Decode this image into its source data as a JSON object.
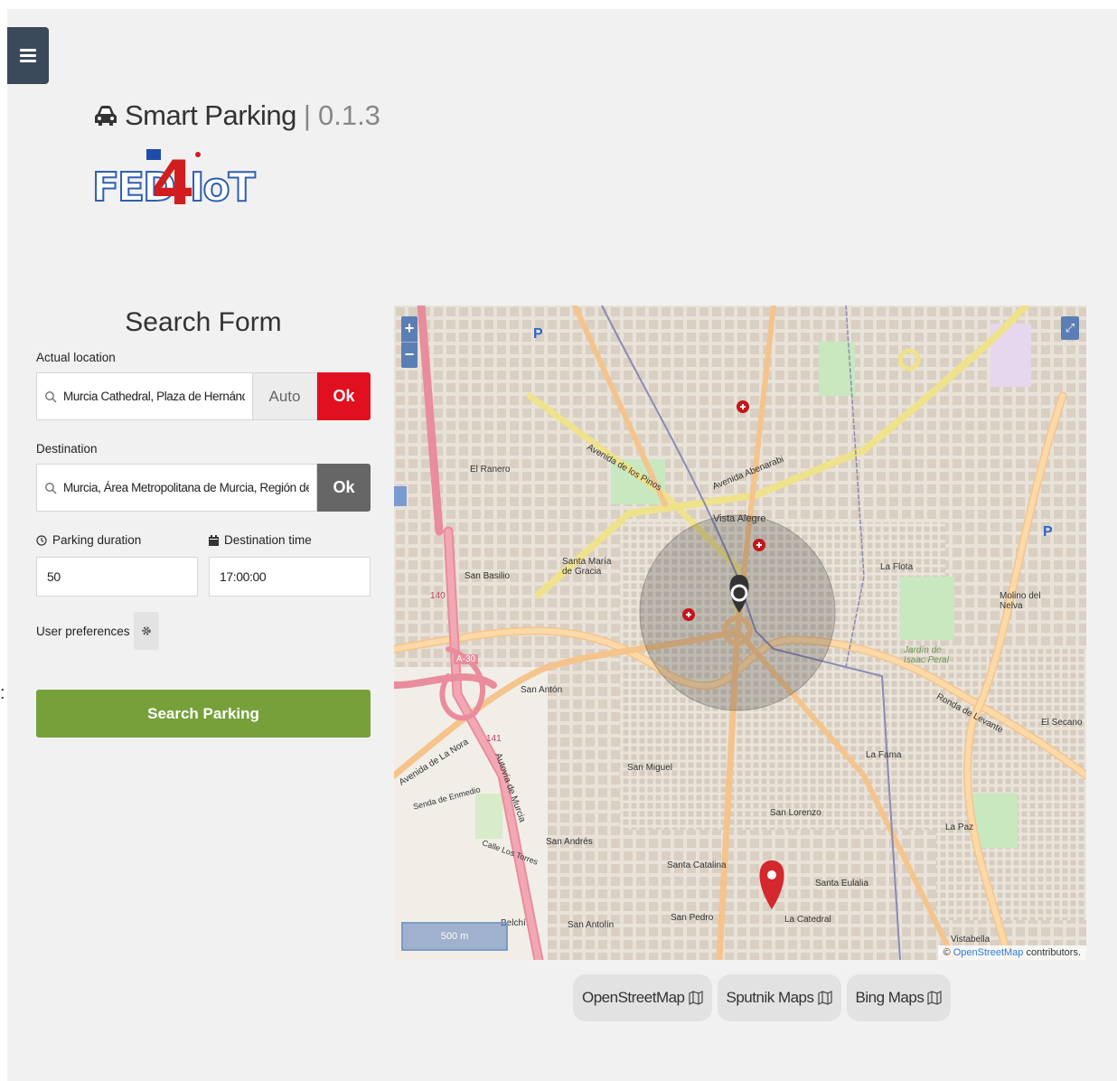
{
  "header": {
    "app_name": "Smart Parking",
    "separator": "|",
    "version": "0.1.3",
    "logo_left": "FED",
    "logo_mid": "4",
    "logo_right": "IoT"
  },
  "form": {
    "title": "Search Form",
    "actual_location_label": "Actual location",
    "actual_location_value": "Murcia Cathedral, Plaza de Hernández Amores",
    "auto_label": "Auto",
    "ok_label": "Ok",
    "destination_label": "Destination",
    "destination_value": "Murcia, Área Metropolitana de Murcia, Región de Murcia",
    "parking_duration_label": "Parking duration",
    "parking_duration_value": "50",
    "destination_time_label": "Destination time",
    "destination_time_value": "17:00:00",
    "user_preferences_label": "User preferences",
    "search_button_label": "Search Parking"
  },
  "map": {
    "zoom_in": "+",
    "zoom_out": "−",
    "scale_label": "500 m",
    "attribution_prefix": "©",
    "attribution_link": "OpenStreetMap",
    "attribution_suffix": "contributors.",
    "labels": {
      "vista_alegre": "Vista Alegre",
      "santa_maria_de_gracia": "Santa María de Gracia",
      "san_basilio": "San Basilio",
      "san_anton": "San Antón",
      "san_miguel": "San Miguel",
      "san_andres": "San Andrés",
      "santa_catalina": "Santa Catalina",
      "san_lorenzo": "San Lorenzo",
      "santa_eulalia": "Santa Eulalia",
      "san_pedro": "San Pedro",
      "san_antolin": "San Antolín",
      "la_catedral": "La Catedral",
      "la_fama": "La Fama",
      "la_flota": "La Flota",
      "la_paz": "La Paz",
      "el_ranero": "El Ranero",
      "el_secano": "El Secano",
      "molino_del_nelva": "Molino del Nelva",
      "vistabella": "Vistabella",
      "belchi": "Belchí",
      "jardin_isaac_peral": "Jardín de Isaac Peral",
      "ronda_de_levante": "Ronda de Levante",
      "avenida_de_los_pinos": "Avenida de los Pinos",
      "avenida_abenarabi": "Avenida Abenarabi",
      "avenida_de_la_nora": "Avenida de La Nora",
      "autovia_de_murcia": "Autovía de Murcia",
      "a30": "A-30",
      "n141": "141",
      "n140": "140",
      "senda_de_enmedio": "Senda de Enmedio",
      "calle_los_torres": "Calle Los Torres"
    }
  },
  "layers": [
    {
      "label": "OpenStreetMap"
    },
    {
      "label": "Sputnik Maps"
    },
    {
      "label": "Bing Maps"
    }
  ],
  "colors": {
    "ok_active": "#e0101f",
    "ok_inactive": "#666666",
    "search_button": "#76a13a",
    "menu_button": "#3b4a5a",
    "map_controls": "#5b7fb5"
  },
  "icons": [
    "menu-icon",
    "car-icon",
    "search-icon",
    "clock-icon",
    "calendar-icon",
    "gear-icon",
    "map-icon",
    "fullscreen-icon",
    "location-pin-icon",
    "destination-pin-icon",
    "hospital-icon",
    "parking-icon"
  ]
}
